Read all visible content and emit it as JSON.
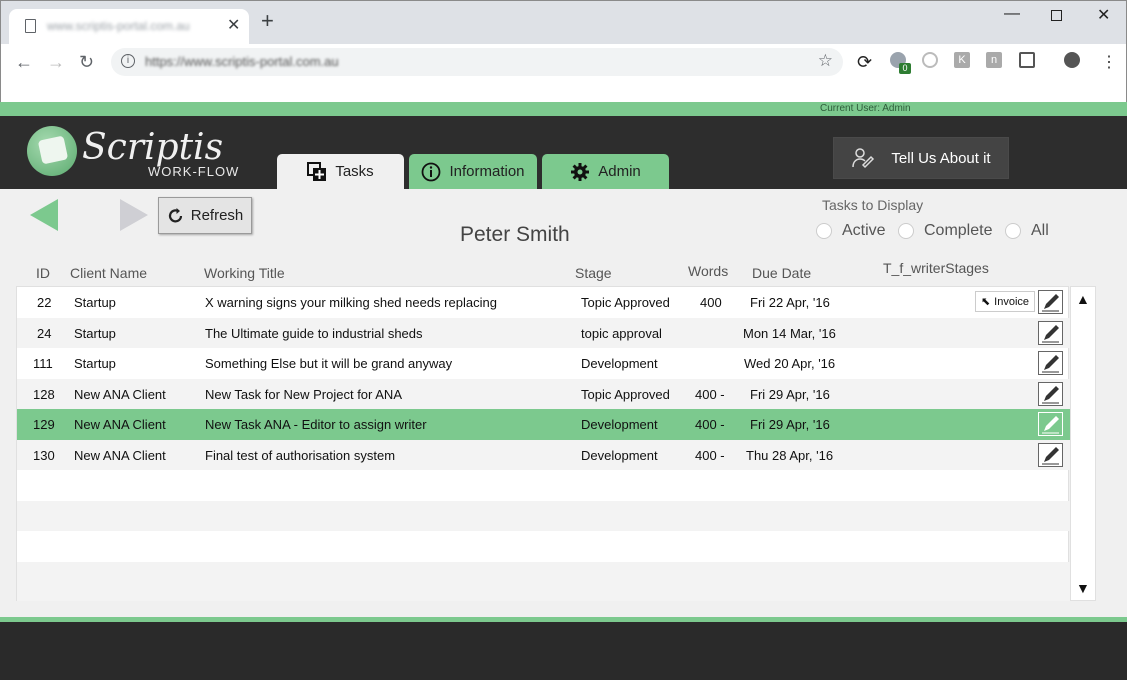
{
  "browser": {
    "tab_title": "www.scriptis-portal.com.au",
    "url": "https://www.scriptis-portal.com.au",
    "extension_badge": "0",
    "ext_k": "K",
    "ext_n": "n"
  },
  "app": {
    "current_user": "Current User: Admin",
    "logo_title": "Scriptis",
    "logo_subtitle": "WORK-FLOW",
    "tabs": [
      {
        "label": "Tasks"
      },
      {
        "label": "Information"
      },
      {
        "label": "Admin"
      }
    ],
    "feedback_label": "Tell Us About it",
    "refresh_label": "Refresh",
    "user_name": "Peter Smith",
    "filter": {
      "label": "Tasks to Display",
      "options": [
        "Active",
        "Complete",
        "All"
      ]
    }
  },
  "grid": {
    "columns": [
      "ID",
      "Client Name",
      "Working Title",
      "Stage",
      "Words",
      "Due Date",
      "T_f_writerStages"
    ],
    "rows": [
      {
        "id": "22",
        "client": "Startup",
        "title": "X warning signs your milking shed needs replacing",
        "stage": "Topic Approved",
        "words": "400",
        "due": "Fri 22 Apr, '16",
        "invoice": "Invoice"
      },
      {
        "id": "24",
        "client": "Startup",
        "title": "The Ultimate guide to industrial sheds",
        "stage": "topic approval",
        "words": "",
        "due": "Mon 14 Mar, '16"
      },
      {
        "id": "111",
        "client": "Startup",
        "title": "Something Else but it will be grand anyway",
        "stage": "Development",
        "words": "",
        "due": "Wed 20 Apr, '16"
      },
      {
        "id": "128",
        "client": "New ANA Client",
        "title": "New Task for New Project for ANA",
        "stage": "Topic Approved",
        "words": "400 -",
        "due": "Fri 29 Apr, '16"
      },
      {
        "id": "129",
        "client": "New ANA Client",
        "title": "New Task ANA - Editor to assign writer",
        "stage": "Development",
        "words": "400 -",
        "due": "Fri 29 Apr, '16"
      },
      {
        "id": "130",
        "client": "New ANA Client",
        "title": "Final test of authorisation system",
        "stage": "Development",
        "words": "400 -",
        "due": "Thu 28 Apr, '16"
      }
    ]
  },
  "colors": {
    "accent": "#7cc98e",
    "header_bg": "#2d2d2d",
    "content_bg": "#f0f0f0"
  }
}
